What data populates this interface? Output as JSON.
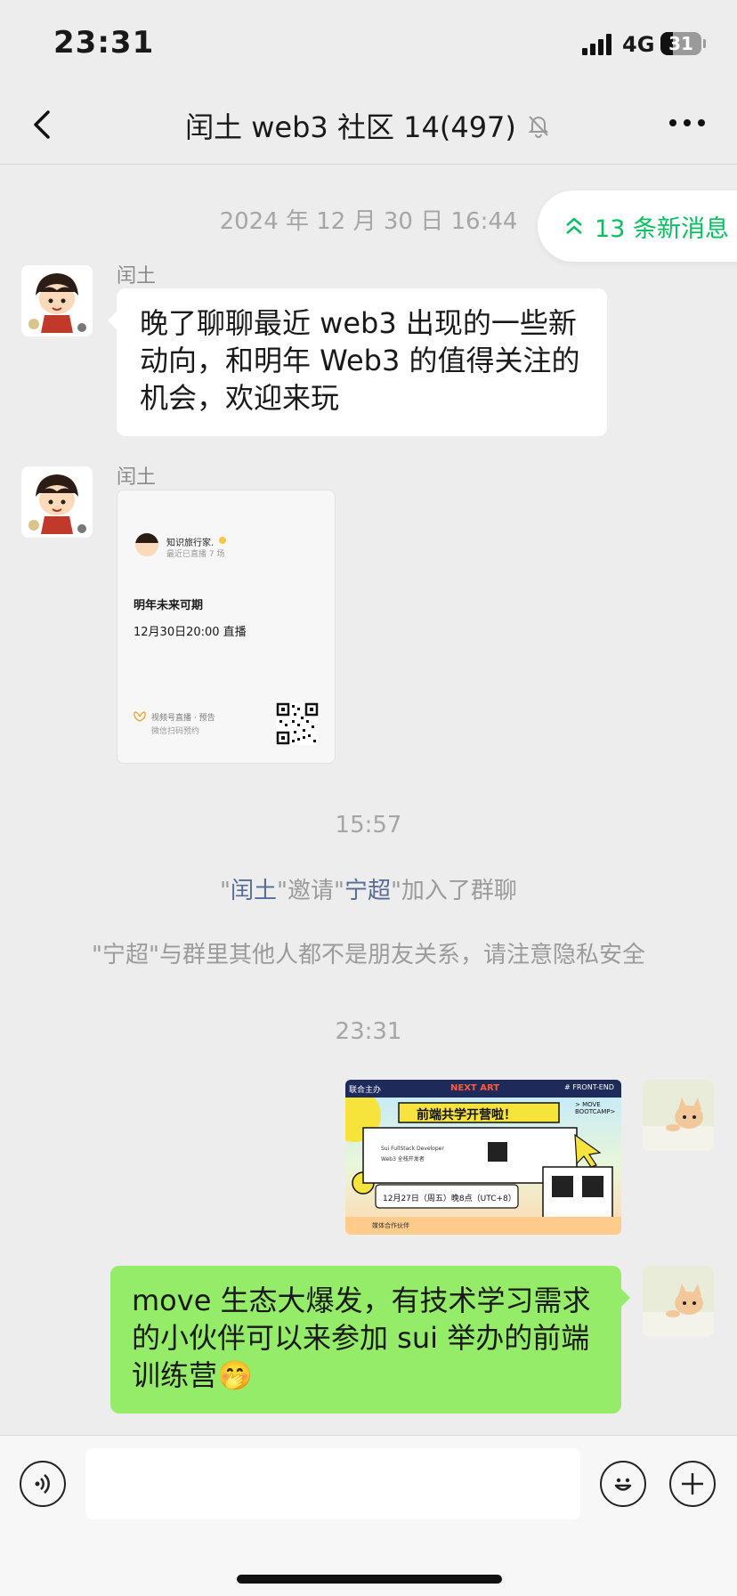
{
  "status_bar": {
    "time": "23:31",
    "network": "4G",
    "battery": "31",
    "battery_level": 0.31
  },
  "nav": {
    "title": "闰土 web3 社区 14(497)"
  },
  "new_messages": {
    "label": "13 条新消息"
  },
  "messages": {
    "timestamp1": "2024 年 12 月 30 日 16:44",
    "msg1": {
      "sender": "闰土",
      "text": "晚了聊聊最近 web3 出现的一些新动向，和明年 Web3 的值得关注的机会，欢迎来玩"
    },
    "msg2": {
      "sender": "闰土",
      "card": {
        "account": "知识旅行家.",
        "subline": "最近已直播 7 场",
        "title": "明年未来可期",
        "time": "12月30日20:00 直播",
        "footer_main": "视频号直播 · 预告",
        "footer_sub": "微信扫码预约"
      }
    },
    "timestamp2": "15:57",
    "system1": {
      "q1": "\"",
      "inviter": "闰土",
      "mid": "\"邀请\"",
      "invitee": "宁超",
      "tail": "\"加入了群聊"
    },
    "system2": "\"宁超\"与群里其他人都不是朋友关系，请注意隐私安全",
    "timestamp3": "23:31",
    "poster": {
      "top_left": "联合主办",
      "brand": "NEXT ART",
      "tag": "# FRONT-END",
      "side": "> MOVE BOOTCAMP>",
      "headline": "前端共学开营啦！",
      "line1": "Sui FullStack Developer",
      "line2": "Web3 全栈开发者",
      "date": "12月27日（周五）晚8点（UTC+8）",
      "bottom": "媒体合作伙伴"
    },
    "msg3": {
      "text": "move 生态大爆发，有技术学习需求的小伙伴可以来参加 sui 举办的前端训练营",
      "emoji": "🤭"
    }
  }
}
